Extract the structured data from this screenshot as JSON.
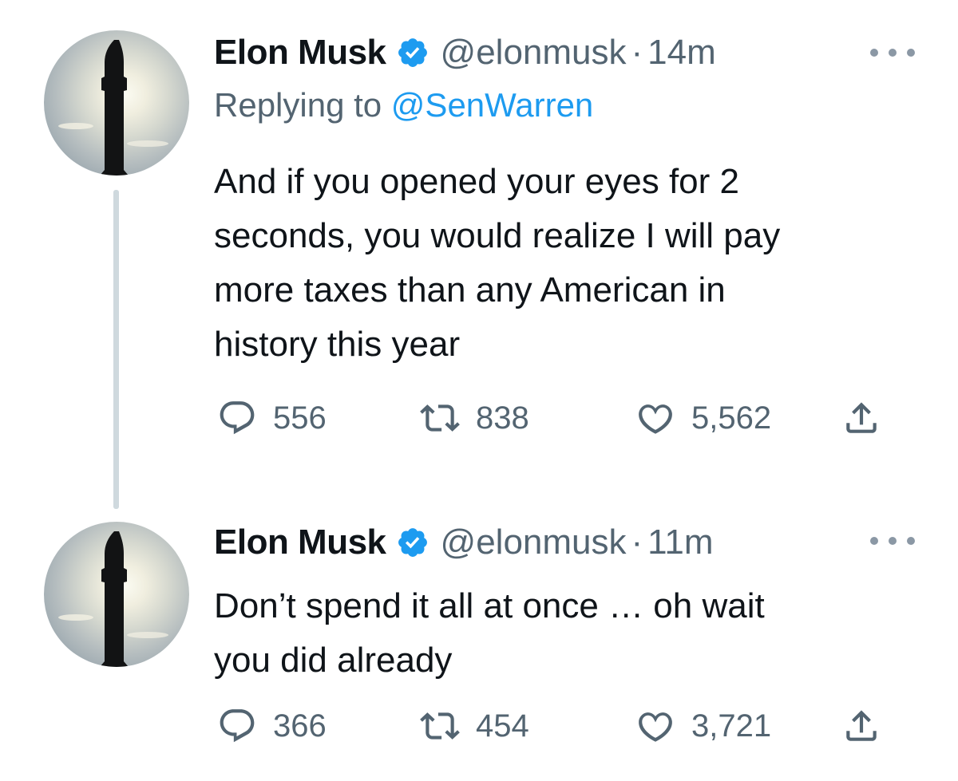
{
  "thread": [
    {
      "author": {
        "name": "Elon Musk",
        "handle": "@elonmusk",
        "verified": true
      },
      "time": "14m",
      "replying_label": "Replying to",
      "replying_to": "@SenWarren",
      "text": "And if you opened your eyes for 2\nseconds, you would realize I will pay\nmore taxes than any American in\nhistory this year",
      "stats": {
        "replies": "556",
        "retweets": "838",
        "likes": "5,562"
      }
    },
    {
      "author": {
        "name": "Elon Musk",
        "handle": "@elonmusk",
        "verified": true
      },
      "time": "11m",
      "text": "Don’t spend it all at once … oh wait\nyou did already",
      "stats": {
        "replies": "366",
        "retweets": "454",
        "likes": "3,721"
      }
    }
  ],
  "icons": {
    "reply": "reply-icon",
    "retweet": "retweet-icon",
    "like": "heart-icon",
    "share": "share-icon",
    "more": "more-icon",
    "verified": "verified-badge-icon"
  },
  "colors": {
    "text": "#0f1419",
    "secondary": "#536471",
    "link": "#1d9bf0",
    "thread_line": "#cfd9de"
  }
}
